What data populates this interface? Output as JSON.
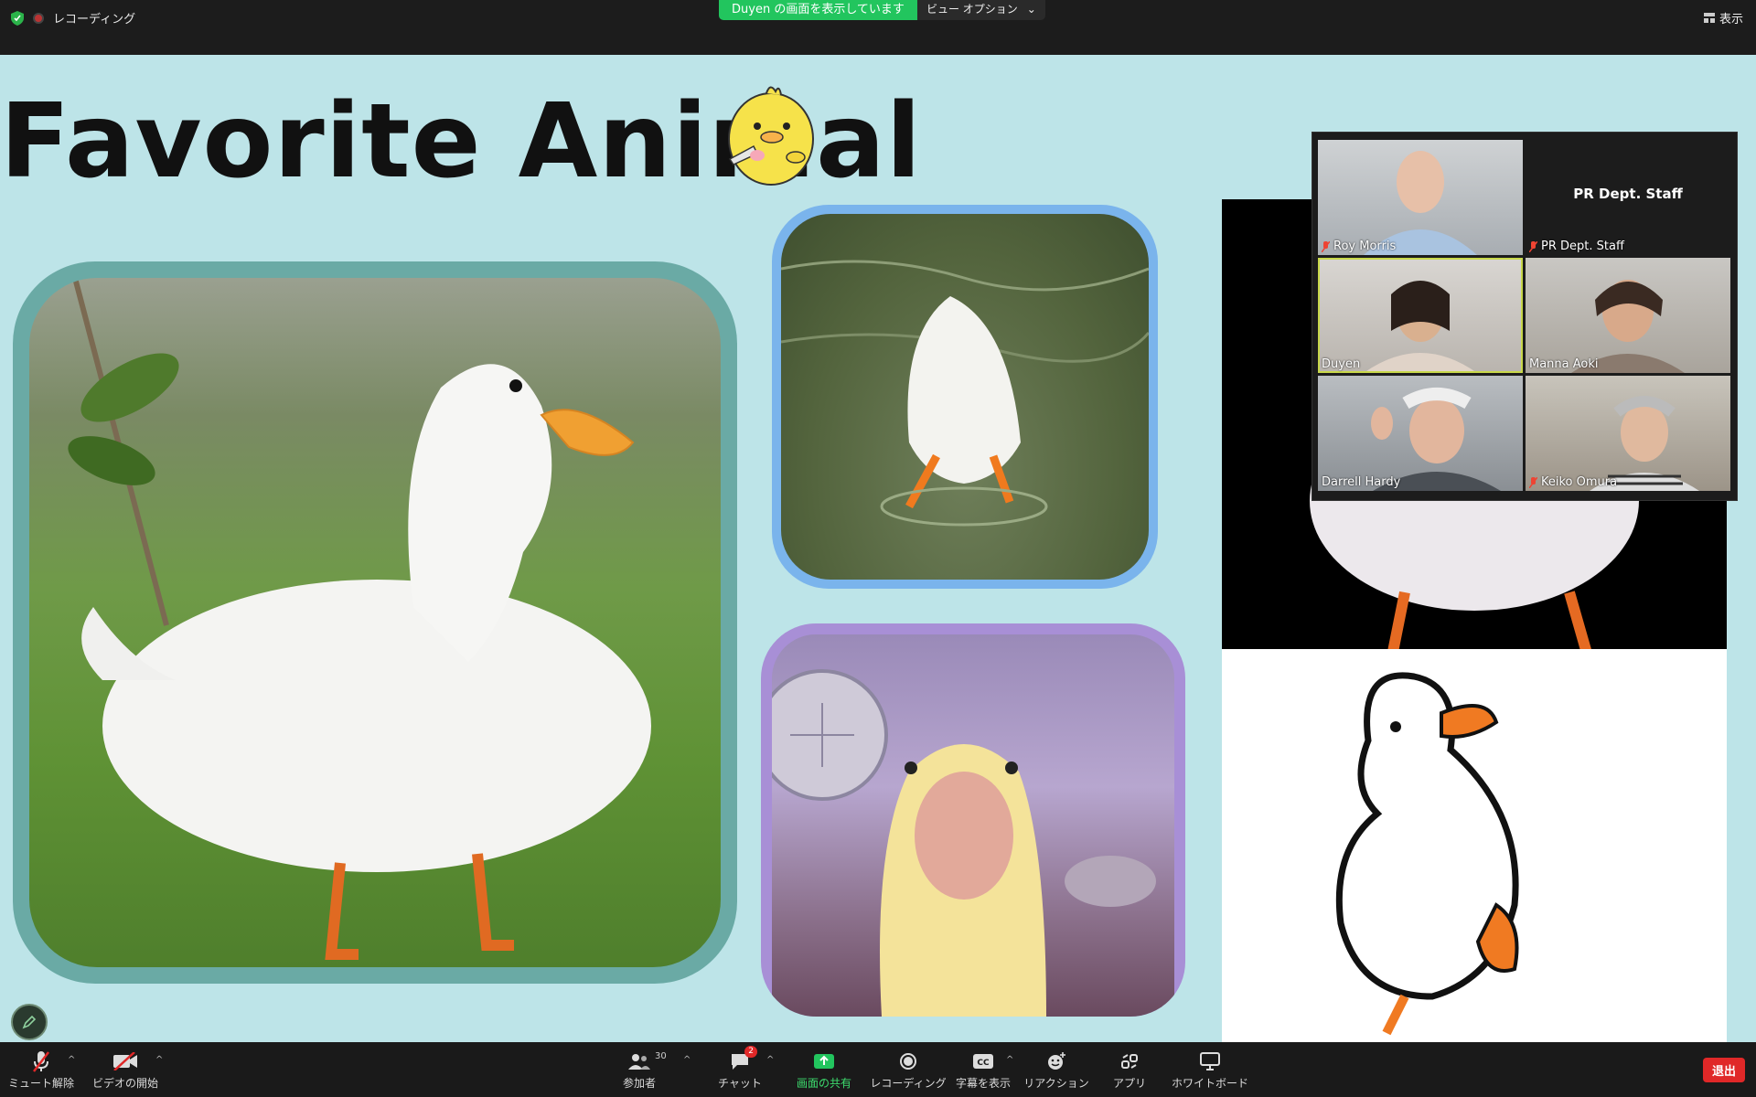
{
  "topbar": {
    "recording_label": "レコーディング",
    "share_banner": "Duyen の画面を表示しています",
    "view_options": "ビュー オプション",
    "view_button": "表示"
  },
  "slide": {
    "title": "Favorite Animal"
  },
  "gallery": {
    "participants": [
      {
        "name": "Roy Morris",
        "muted": true
      },
      {
        "name": "PR Dept. Staff",
        "muted": true,
        "display_name": "PR Dept. Staff"
      },
      {
        "name": "Duyen",
        "muted": false,
        "active_speaker": true
      },
      {
        "name": "Manna Aoki",
        "muted": false
      },
      {
        "name": "Darrell Hardy",
        "muted": false
      },
      {
        "name": "Keiko Omura",
        "muted": true
      }
    ]
  },
  "toolbar": {
    "unmute": "ミュート解除",
    "start_video": "ビデオの開始",
    "participants": "参加者",
    "participants_count": "30",
    "chat": "チャット",
    "chat_badge": "2",
    "share_screen": "画面の共有",
    "recording": "レコーディング",
    "captions": "字幕を表示",
    "reactions": "リアクション",
    "apps": "アプリ",
    "whiteboard": "ホワイトボード",
    "leave": "退出"
  },
  "colors": {
    "share_green": "#22c55e",
    "leave_red": "#e02828",
    "slide_bg": "#bde4e8",
    "active_speaker": "#c8d84a"
  }
}
